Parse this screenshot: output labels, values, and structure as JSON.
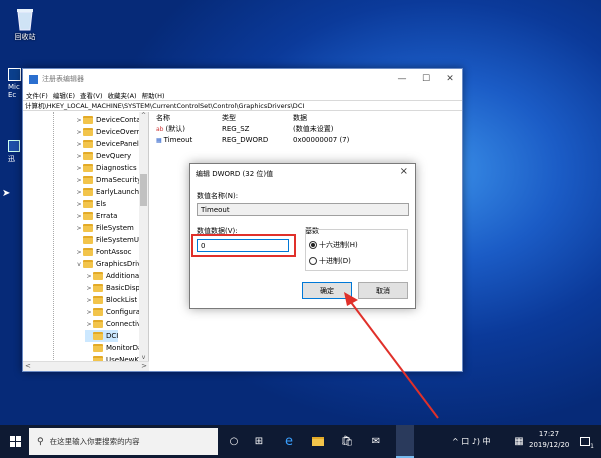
{
  "desktop": {
    "recycle_bin_label": "回收站",
    "left_fragments": [
      "Mic",
      "Ec",
      "迅"
    ]
  },
  "window": {
    "title": "注册表编辑器",
    "menu": [
      "文件(F)",
      "编辑(E)",
      "查看(V)",
      "收藏夹(A)",
      "帮助(H)"
    ],
    "address": "计算机\\HKEY_LOCAL_MACHINE\\SYSTEM\\CurrentControlSet\\Control\\GraphicsDrivers\\DCI",
    "tree": [
      {
        "label": "DeviceContai",
        "depth": 0,
        "chevron": ">"
      },
      {
        "label": "DeviceOverri",
        "depth": 0,
        "chevron": ">"
      },
      {
        "label": "DevicePanels",
        "depth": 0,
        "chevron": ">"
      },
      {
        "label": "DevQuery",
        "depth": 0,
        "chevron": ">"
      },
      {
        "label": "Diagnostics",
        "depth": 0,
        "chevron": ">"
      },
      {
        "label": "DmaSecurity",
        "depth": 0,
        "chevron": ">"
      },
      {
        "label": "EarlyLaunch",
        "depth": 0,
        "chevron": ">"
      },
      {
        "label": "Els",
        "depth": 0,
        "chevron": ">"
      },
      {
        "label": "Errata",
        "depth": 0,
        "chevron": ">"
      },
      {
        "label": "FileSystem",
        "depth": 0,
        "chevron": ">"
      },
      {
        "label": "FileSystemUti",
        "depth": 0,
        "chevron": ""
      },
      {
        "label": "FontAssoc",
        "depth": 0,
        "chevron": ">"
      },
      {
        "label": "GraphicsDriv",
        "depth": 0,
        "chevron": "v"
      },
      {
        "label": "Additional",
        "depth": 1,
        "chevron": ">"
      },
      {
        "label": "BasicDispl",
        "depth": 1,
        "chevron": ">"
      },
      {
        "label": "BlockList",
        "depth": 1,
        "chevron": ">"
      },
      {
        "label": "Configurat",
        "depth": 1,
        "chevron": ">"
      },
      {
        "label": "Connectivi",
        "depth": 1,
        "chevron": ">"
      },
      {
        "label": "DCI",
        "depth": 1,
        "chevron": "",
        "selected": true
      },
      {
        "label": "MonitorDa",
        "depth": 1,
        "chevron": ""
      },
      {
        "label": "UseNewK",
        "depth": 1,
        "chevron": ""
      }
    ],
    "columns": {
      "name": "名称",
      "type": "类型",
      "data": "数据"
    },
    "values": [
      {
        "name": "(默认)",
        "type": "REG_SZ",
        "data": "(数值未设置)"
      },
      {
        "name": "Timeout",
        "type": "REG_DWORD",
        "data": "0x00000007 (7)"
      }
    ]
  },
  "dialog": {
    "title": "编辑 DWORD (32 位)值",
    "close": "×",
    "name_label": "数值名称(N):",
    "name_value": "Timeout",
    "data_label": "数值数据(V):",
    "data_value": "0",
    "base_label": "基数",
    "hex_label": "十六进制(H)",
    "dec_label": "十进制(D)",
    "ok_label": "确定",
    "cancel_label": "取消"
  },
  "taskbar": {
    "search_placeholder": "在这里输入你要搜索的内容",
    "tray_text": "^ 口 ♪) 中",
    "time": "17:27",
    "date": "2019/12/20",
    "notification_count": "1"
  },
  "colors": {
    "highlight_red": "#e0302a",
    "selection_blue": "#cce8ff",
    "desktop_blue": "#1b5cc6"
  }
}
